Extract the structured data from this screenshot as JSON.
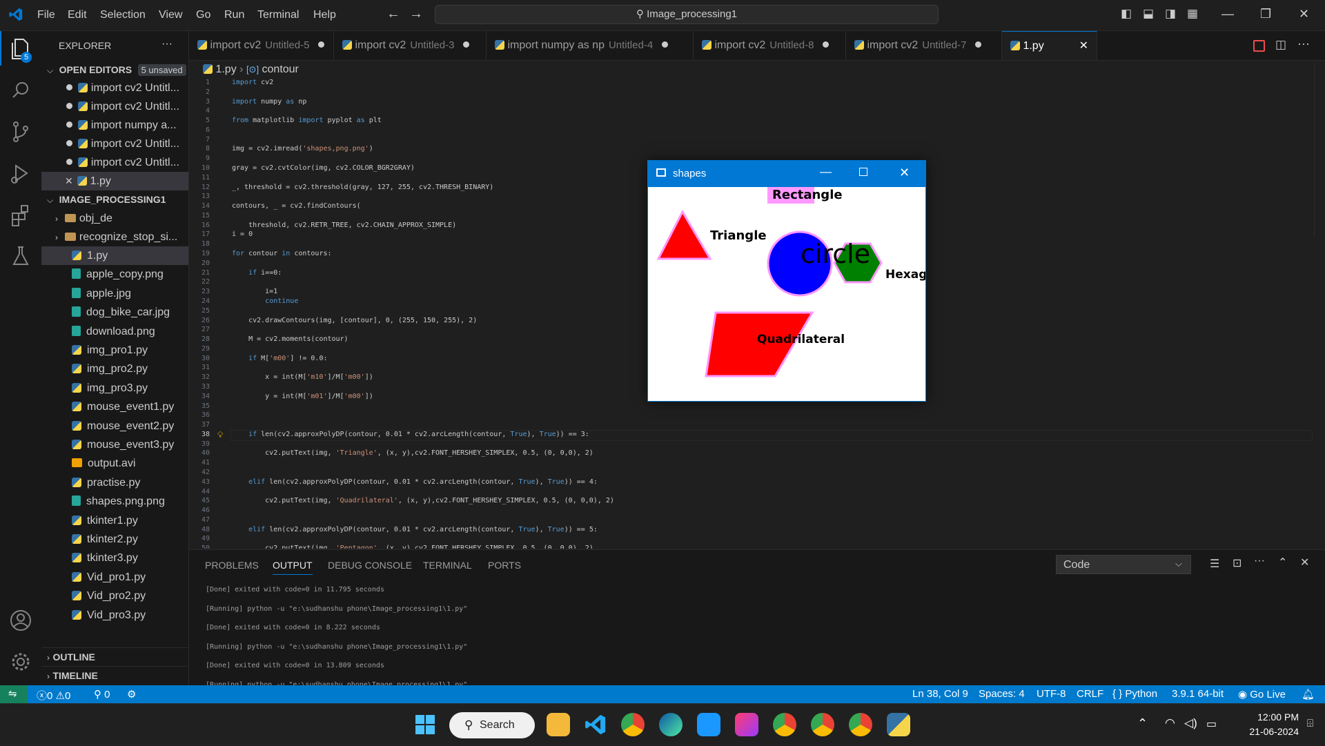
{
  "titlebar": {
    "menu": [
      "File",
      "Edit",
      "Selection",
      "View",
      "Go",
      "Run",
      "Terminal",
      "Help"
    ],
    "search_text": "Image_processing1",
    "vscode_logo": "vscode-logo-icon"
  },
  "activity_bar": {
    "explorer_badge": "5",
    "icons": [
      "files-icon",
      "search-icon",
      "source-control-icon",
      "run-debug-icon",
      "extensions-icon",
      "testing-icon",
      "account-icon",
      "settings-gear-icon"
    ]
  },
  "sidebar": {
    "title": "EXPLORER",
    "more": "···",
    "open_editors": {
      "label": "OPEN EDITORS",
      "badge": "5 unsaved",
      "items": [
        "import cv2  Untitl...",
        "import cv2  Untitl...",
        "import numpy a...",
        "import cv2  Untitl...",
        "import cv2  Untitl...",
        "1.py"
      ]
    },
    "project": {
      "label": "IMAGE_PROCESSING1",
      "folders": [
        "obj_de",
        "recognize_stop_si..."
      ],
      "files": [
        {
          "name": "1.py",
          "type": "py"
        },
        {
          "name": "apple_copy.png",
          "type": "img"
        },
        {
          "name": "apple.jpg",
          "type": "img"
        },
        {
          "name": "dog_bike_car.jpg",
          "type": "img"
        },
        {
          "name": "download.png",
          "type": "img"
        },
        {
          "name": "img_pro1.py",
          "type": "py"
        },
        {
          "name": "img_pro2.py",
          "type": "py"
        },
        {
          "name": "img_pro3.py",
          "type": "py"
        },
        {
          "name": "mouse_event1.py",
          "type": "py"
        },
        {
          "name": "mouse_event2.py",
          "type": "py"
        },
        {
          "name": "mouse_event3.py",
          "type": "py"
        },
        {
          "name": "output.avi",
          "type": "vid"
        },
        {
          "name": "practise.py",
          "type": "py"
        },
        {
          "name": "shapes.png.png",
          "type": "img"
        },
        {
          "name": "tkinter1.py",
          "type": "py"
        },
        {
          "name": "tkinter2.py",
          "type": "py"
        },
        {
          "name": "tkinter3.py",
          "type": "py"
        },
        {
          "name": "Vid_pro1.py",
          "type": "py"
        },
        {
          "name": "Vid_pro2.py",
          "type": "py"
        },
        {
          "name": "Vid_pro3.py",
          "type": "py"
        }
      ]
    },
    "outline": "OUTLINE",
    "timeline": "TIMELINE"
  },
  "tabs": [
    {
      "title": "import cv2",
      "sub": "Untitled-5"
    },
    {
      "title": "import cv2",
      "sub": "Untitled-3"
    },
    {
      "title": "import numpy as np",
      "sub": "Untitled-4"
    },
    {
      "title": "import cv2",
      "sub": "Untitled-8"
    },
    {
      "title": "import cv2",
      "sub": "Untitled-7"
    },
    {
      "title": "1.py",
      "sub": ""
    }
  ],
  "breadcrumb": {
    "file": "1.py",
    "symbol": "contour"
  },
  "code_lines": [
    "import cv2",
    "",
    "import numpy as np",
    "",
    "from matplotlib import pyplot as plt",
    "",
    "",
    "img = cv2.imread('shapes,png.png')",
    "",
    "gray = cv2.cvtColor(img, cv2.COLOR_BGR2GRAY)",
    "",
    "_, threshold = cv2.threshold(gray, 127, 255, cv2.THRESH_BINARY)",
    "",
    "contours, _ = cv2.findContours(",
    "",
    "    threshold, cv2.RETR_TREE, cv2.CHAIN_APPROX_SIMPLE)",
    "i = 0",
    "",
    "for contour in contours:",
    "",
    "    if i==0:",
    "",
    "        i=1",
    "        continue",
    "",
    "    cv2.drawContours(img, [contour], 0, (255, 150, 255), 2)",
    "",
    "    M = cv2.moments(contour)",
    "",
    "    if M['m00'] != 0.0:",
    "",
    "        x = int(M['m10']/M['m00'])",
    "",
    "        y = int(M['m01']/M['m00'])",
    "",
    "",
    "",
    "    if len(cv2.approxPolyDP(contour, 0.01 * cv2.arcLength(contour, True), True)) == 3:",
    "",
    "        cv2.putText(img, 'Triangle', (x, y),cv2.FONT_HERSHEY_SIMPLEX, 0.5, (0, 0,0), 2)",
    "",
    "",
    "    elif len(cv2.approxPolyDP(contour, 0.01 * cv2.arcLength(contour, True), True)) == 4:",
    "",
    "        cv2.putText(img, 'Quadrilateral', (x, y),cv2.FONT_HERSHEY_SIMPLEX, 0.5, (0, 0,0), 2)",
    "",
    "",
    "    elif len(cv2.approxPolyDP(contour, 0.01 * cv2.arcLength(contour, True), True)) == 5:",
    "",
    "        cv2.putText(img, 'Pentagon', (x, y),cv2.FONT_HERSHEY_SIMPLEX, 0.5, (0, 0,0), 2)"
  ],
  "panel": {
    "tabs": [
      "PROBLEMS",
      "OUTPUT",
      "DEBUG CONSOLE",
      "TERMINAL",
      "PORTS"
    ],
    "active_tab": "OUTPUT",
    "dropdown": "Code",
    "output_lines": [
      "[Done] exited with code=0 in 11.795 seconds",
      "[Running] python -u \"e:\\sudhanshu phone\\Image_processing1\\1.py\"",
      "[Done] exited with code=0 in 8.222 seconds",
      "[Running] python -u \"e:\\sudhanshu phone\\Image_processing1\\1.py\"",
      "[Done] exited with code=0 in 13.809 seconds",
      "[Running] python -u \"e:\\sudhanshu phone\\Image_processing1\\1.py\""
    ]
  },
  "statusbar": {
    "errors": "0",
    "warnings": "0",
    "ports": "0",
    "position": "Ln 38, Col 9",
    "spaces": "Spaces: 4",
    "encoding": "UTF-8",
    "eol": "CRLF",
    "language": "Python",
    "interpreter": "3.9.1 64-bit",
    "golive": "Go Live"
  },
  "shapes_window": {
    "title": "shapes",
    "labels": [
      "Triangle",
      "circle",
      "Hexag",
      "Quadrilateral",
      "Rectangle"
    ]
  },
  "taskbar": {
    "search": "Search",
    "time": "12:00 PM",
    "date": "21-06-2024"
  },
  "colors": {
    "accent": "#0078d4",
    "statusbar": "#007acc",
    "keyword": "#569cd6",
    "string": "#ce9178",
    "number": "#b5cea8"
  }
}
